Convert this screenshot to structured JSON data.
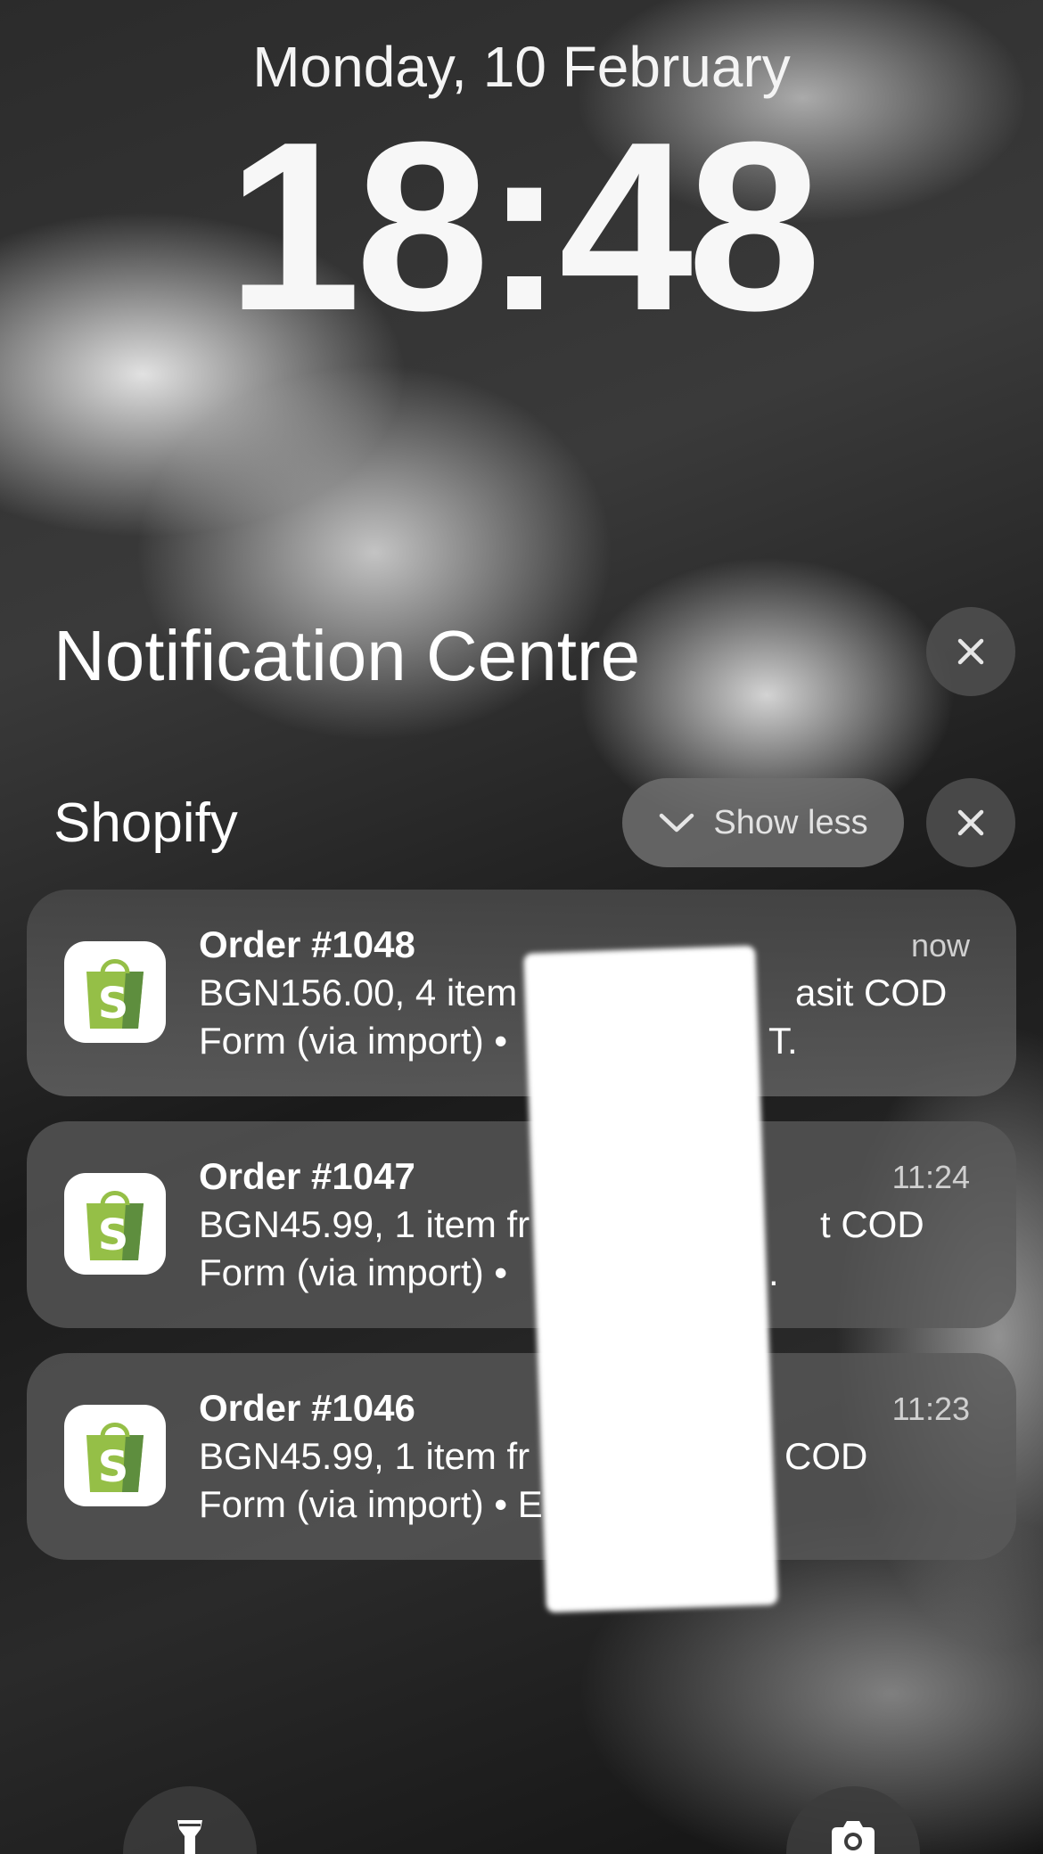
{
  "lock_screen": {
    "date": "Monday, 10 February",
    "time": "18:48"
  },
  "notification_centre": {
    "title": "Notification Centre",
    "group": {
      "app_name": "Shopify",
      "show_less_label": "Show less"
    },
    "notifications": [
      {
        "title": "Order #1048",
        "time": "now",
        "line1": "BGN156.00, 4 item",
        "line1_tail": "asit COD",
        "line2": "Form (via import) •",
        "line2_tail": "T."
      },
      {
        "title": "Order #1047",
        "time": "11:24",
        "line1": "BGN45.99, 1 item fr",
        "line1_tail": "t COD",
        "line2": "Form (via import) •",
        "line2_tail": "."
      },
      {
        "title": "Order #1046",
        "time": "11:23",
        "line1": "BGN45.99, 1 item fr",
        "line1_tail": "COD",
        "line2": "Form (via import) • E",
        "line2_tail": ""
      }
    ]
  },
  "colors": {
    "shopify_green": "#95BF47",
    "shopify_dark_green": "#5E8E3E"
  },
  "icons": {
    "close": "close-icon",
    "chevron": "chevron-down-icon",
    "app": "shopify-icon",
    "flashlight": "flashlight-icon",
    "camera": "camera-icon"
  }
}
